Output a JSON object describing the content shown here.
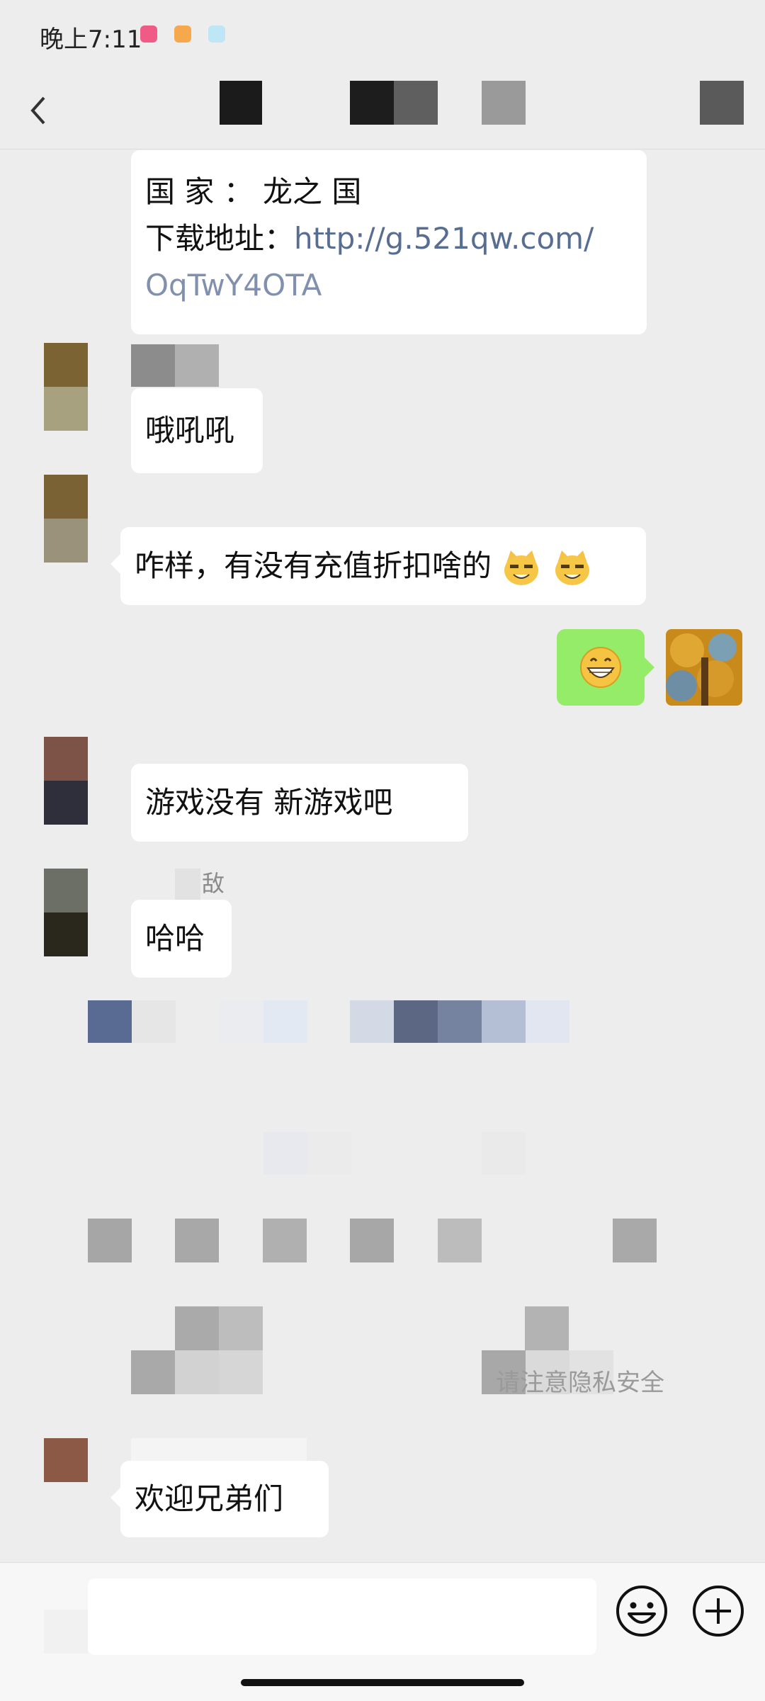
{
  "status_bar": {
    "time": "晚上7:11"
  },
  "messages": [
    {
      "id": "info",
      "lines": [
        "国 家 ： 龙之 国",
        "下载地址："
      ],
      "link_part1": "http://g.521qw.com/",
      "link_part2": "OqTwY4OTA"
    },
    {
      "id": "m1",
      "text": "哦吼吼"
    },
    {
      "id": "m2",
      "text": "咋样，有没有充值折扣啥的"
    },
    {
      "id": "m3",
      "text": "游戏没有 新游戏吧"
    },
    {
      "id": "m4",
      "sender": "敌",
      "text": "哈哈"
    },
    {
      "id": "m5",
      "text": "欢迎兄弟们"
    }
  ],
  "notice": "请注意隐私安全",
  "icons": {
    "back": "chevron-left-icon",
    "emoji": "emoji-face-icon",
    "plus": "plus-circle-icon"
  },
  "colors": {
    "background": "#ededed",
    "bubble_white": "#ffffff",
    "bubble_green": "#95ec69",
    "link": "#586d92"
  }
}
